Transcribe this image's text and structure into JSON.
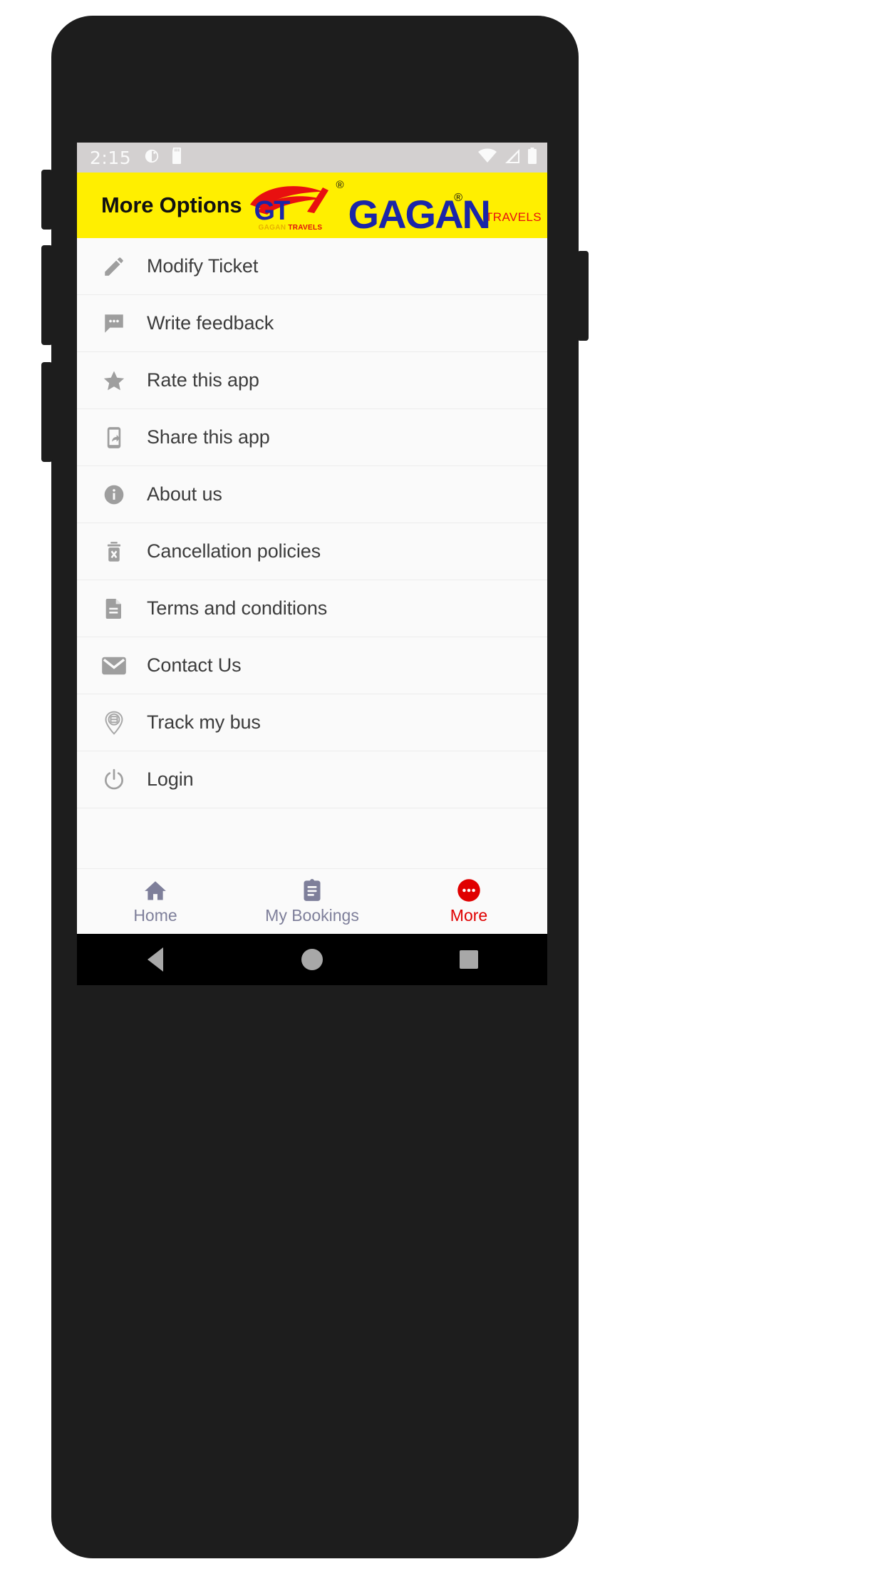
{
  "status_bar": {
    "time": "2:15",
    "left_icons": [
      "alarm-icon",
      "sd-card-icon"
    ],
    "right_icons": [
      "wifi-icon",
      "cellular-signal-icon",
      "battery-icon"
    ],
    "background_color": "#d3d0d0"
  },
  "header": {
    "title": "More Options",
    "background_color": "#ffef00",
    "logo": {
      "mark_text": "GT",
      "mark_subtitle_part1": "GAGAN ",
      "mark_subtitle_part2": "TRAVELS",
      "registered_symbol": "®",
      "brand_word": "GAGAN",
      "brand_suffix": "TRAVELS",
      "brand_color": "#1a25a8",
      "suffix_color": "#e81010"
    }
  },
  "options": [
    {
      "icon": "pencil-icon",
      "label": "Modify Ticket"
    },
    {
      "icon": "chat-bubble-icon",
      "label": "Write feedback"
    },
    {
      "icon": "star-icon",
      "label": "Rate this app"
    },
    {
      "icon": "share-phone-icon",
      "label": "Share this app"
    },
    {
      "icon": "info-circle-icon",
      "label": "About us"
    },
    {
      "icon": "delete-trash-x-icon",
      "label": "Cancellation policies"
    },
    {
      "icon": "document-icon",
      "label": "Terms and conditions"
    },
    {
      "icon": "envelope-icon",
      "label": "Contact Us"
    },
    {
      "icon": "map-pin-bus-icon",
      "label": "Track my bus"
    },
    {
      "icon": "power-icon",
      "label": "Login"
    }
  ],
  "tab_bar": {
    "items": [
      {
        "icon": "home-icon",
        "label": "Home",
        "active": false
      },
      {
        "icon": "clipboard-icon",
        "label": "My Bookings",
        "active": false
      },
      {
        "icon": "more-dots-icon",
        "label": "More",
        "active": true
      }
    ],
    "inactive_color": "#7e7f9a",
    "active_color": "#e00000"
  },
  "nav_bar": {
    "buttons": [
      "back-icon",
      "home-circle-icon",
      "recents-square-icon"
    ],
    "color": "#a8a8a8"
  }
}
